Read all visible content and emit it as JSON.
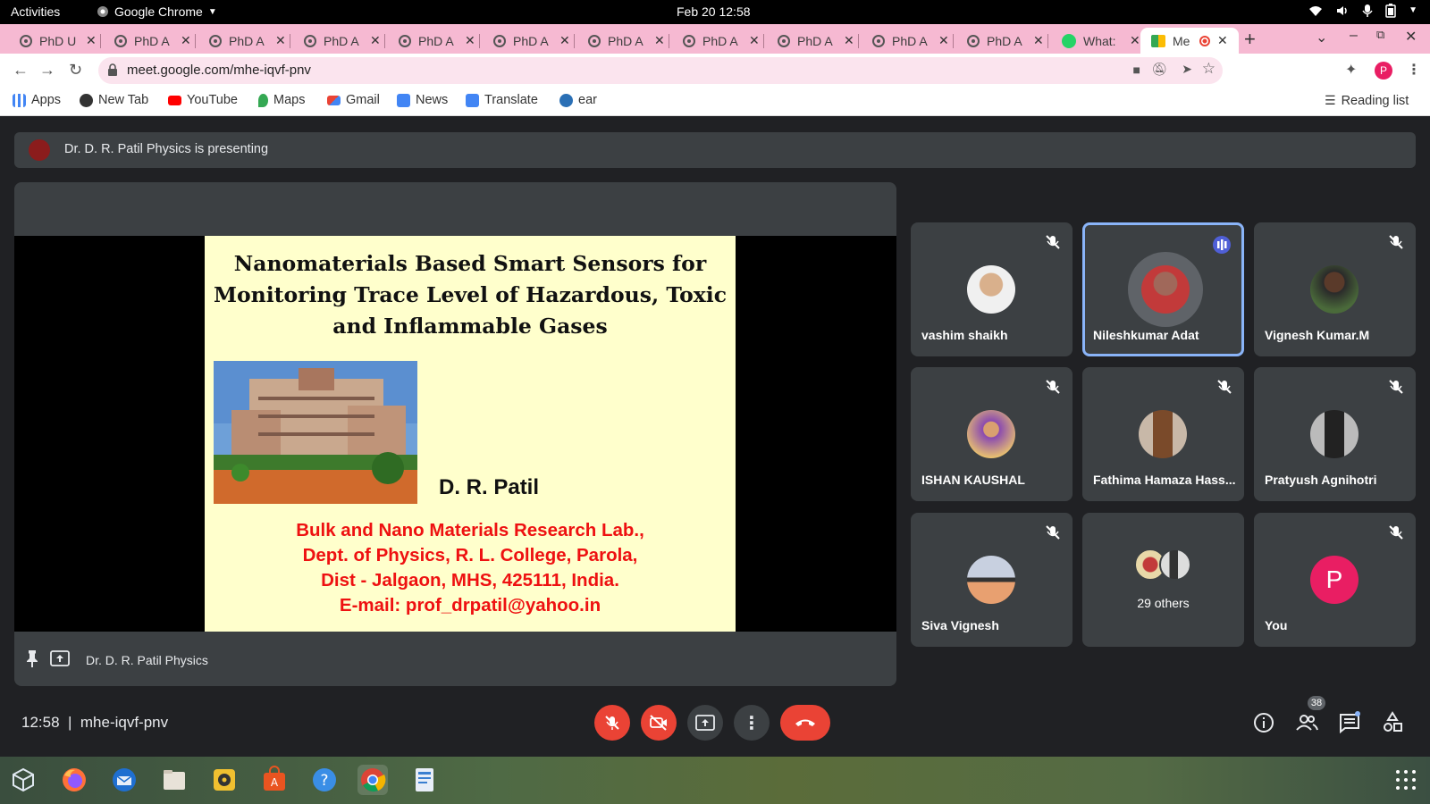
{
  "system": {
    "activities": "Activities",
    "app_name": "Google Chrome",
    "clock": "Feb 20  12:58"
  },
  "tabs": [
    {
      "label": "PhD U"
    },
    {
      "label": "PhD A"
    },
    {
      "label": "PhD A"
    },
    {
      "label": "PhD A"
    },
    {
      "label": "PhD A"
    },
    {
      "label": "PhD A"
    },
    {
      "label": "PhD A"
    },
    {
      "label": "PhD A"
    },
    {
      "label": "PhD A"
    },
    {
      "label": "PhD A"
    },
    {
      "label": "PhD A"
    },
    {
      "label": "What:"
    },
    {
      "label": "Me"
    }
  ],
  "toolbar": {
    "url": "meet.google.com/mhe-iqvf-pnv",
    "profile_initial": "P"
  },
  "bookmarks": [
    {
      "label": "Apps",
      "icon": "apps-grid-icon",
      "color": "#4285f4"
    },
    {
      "label": "New Tab",
      "icon": "globe-icon",
      "color": "#333333"
    },
    {
      "label": "YouTube",
      "icon": "youtube-icon",
      "color": "#ff0000"
    },
    {
      "label": "Maps",
      "icon": "maps-icon",
      "color": "#34a853"
    },
    {
      "label": "Gmail",
      "icon": "gmail-icon",
      "color": "#ea4335"
    },
    {
      "label": "News",
      "icon": "news-icon",
      "color": "#4285f4"
    },
    {
      "label": "Translate",
      "icon": "translate-icon",
      "color": "#4285f4"
    },
    {
      "label": "ear",
      "icon": "ear-icon",
      "color": "#2a6fb5"
    }
  ],
  "reading_list": "Reading list",
  "meet": {
    "presenting_banner": "Dr. D. R. Patil Physics is presenting",
    "presenter_name": "Dr. D. R. Patil Physics",
    "slide": {
      "title_lines": [
        "Nanomaterials Based Smart Sensors for",
        "Monitoring Trace Level of Hazardous, Toxic",
        "and Inflammable Gases"
      ],
      "author": "D. R. Patil",
      "affiliation_lines": [
        "Bulk and Nano Materials Research Lab.,",
        "Dept. of Physics, R. L. College, Parola,",
        "Dist - Jalgaon, MHS, 425111, India.",
        "E-mail: prof_drpatil@yahoo.in"
      ]
    },
    "participants": [
      {
        "name": "vashim shaikh",
        "muted": true
      },
      {
        "name": "Nileshkumar Adat",
        "muted": false,
        "speaking": true
      },
      {
        "name": "Vignesh Kumar.M",
        "muted": true
      },
      {
        "name": "ISHAN KAUSHAL",
        "muted": true
      },
      {
        "name": "Fathima Hamaza Hass...",
        "muted": true
      },
      {
        "name": "Pratyush Agnihotri",
        "muted": true
      },
      {
        "name": "Siva Vignesh",
        "muted": true
      },
      {
        "name": "29 others"
      },
      {
        "name": "You",
        "muted": true,
        "initial": "P"
      }
    ],
    "bottom": {
      "time": "12:58",
      "separator": "|",
      "meeting_code": "mhe-iqvf-pnv",
      "people_count": "38"
    }
  },
  "colors": {
    "tabstrip": "#f6b9d2",
    "meet_bg": "#202124",
    "tile_bg": "#3c4043",
    "red_button": "#ea4335",
    "speaking_border": "#8ab4f8",
    "you_avatar": "#e91e63"
  }
}
